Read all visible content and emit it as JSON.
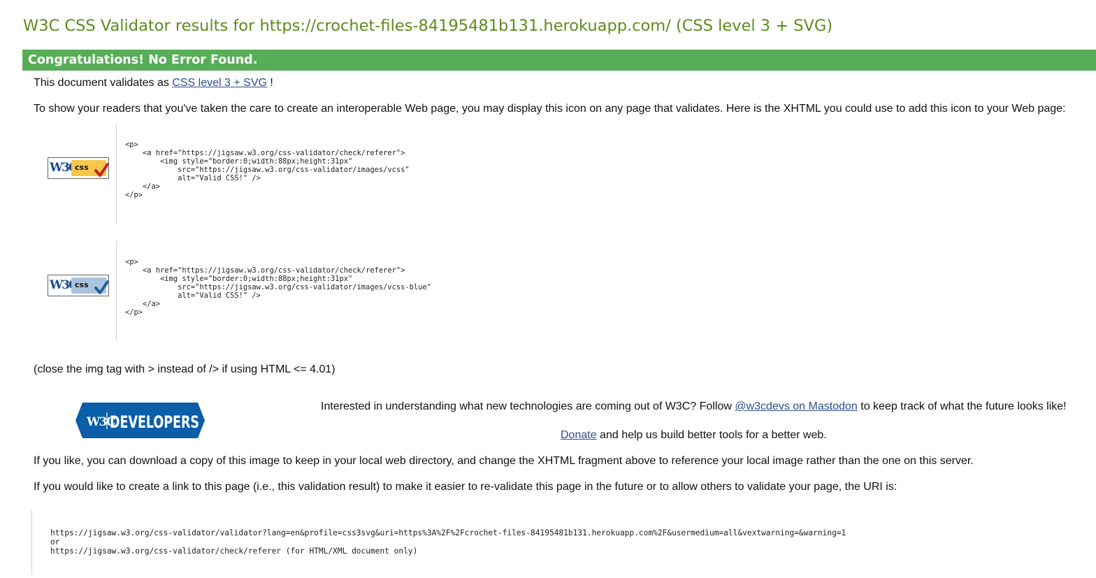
{
  "page": {
    "title": "W3C CSS Validator results for https://crochet-files-84195481b131.herokuapp.com/ (CSS level 3 + SVG)",
    "banner": "Congratulations! No Error Found."
  },
  "validates": {
    "prefix": "This document validates as",
    "link": "CSS level 3 + SVG",
    "suffix": "!"
  },
  "intro": "To show your readers that you've taken the care to create an interoperable Web page, you may display this icon on any page that validates. Here is the XHTML you could use to add this icon to your Web page:",
  "badges": [
    {
      "icon": "w3c-css-valid-gold-badge-icon",
      "w3c_text": "W3C",
      "css_text": "css",
      "color": "#f5c84b",
      "check_color": "#c0241d",
      "code": "<p>\n    <a href=\"https://jigsaw.w3.org/css-validator/check/referer\">\n        <img style=\"border:0;width:88px;height:31px\"\n            src=\"https://jigsaw.w3.org/css-validator/images/vcss\"\n            alt=\"Valid CSS!\" />\n    </a>\n</p>"
    },
    {
      "icon": "w3c-css-valid-blue-badge-icon",
      "w3c_text": "W3C",
      "css_text": "css",
      "color": "#a9c4de",
      "check_color": "#1f5f9e",
      "code": "<p>\n    <a href=\"https://jigsaw.w3.org/css-validator/check/referer\">\n        <img style=\"border:0;width:88px;height:31px\"\n            src=\"https://jigsaw.w3.org/css-validator/images/vcss-blue\"\n            alt=\"Valid CSS!\" />\n    </a>\n</p>"
    }
  ],
  "close_tag_note": "(close the img tag with > instead of /> if using HTML <= 4.01)",
  "developers": {
    "logo_w3c": "W3C",
    "logo_text": "DEVELOPERS",
    "logo_color": "#0b5ea8",
    "interest_prefix": "Interested in understanding what new technologies are coming out of W3C? Follow",
    "mastodon_link": "@w3cdevs on Mastodon",
    "interest_suffix": "to keep track of what the future looks like!",
    "donate_link": "Donate",
    "donate_suffix": "and help us build better tools for a better web."
  },
  "download_note": "If you like, you can download a copy of this image to keep in your local web directory, and change the XHTML fragment above to reference your local image rather than the one on this server.",
  "link_note": "If you would like to create a link to this page (i.e., this validation result) to make it easier to re-validate this page in the future or to allow others to validate your page, the URI is:",
  "uri_block": "https://jigsaw.w3.org/css-validator/validator?lang=en&profile=css3svg&uri=https%3A%2F%2Fcrochet-files-84195481b131.herokuapp.com%2F&usermedium=all&vextwarning=&warning=1\nor\nhttps://jigsaw.w3.org/css-validator/check/referer (for HTML/XML document only)",
  "colors": {
    "title": "#5c8c1c",
    "banner": "#58ae58",
    "link": "#2f4d88"
  }
}
